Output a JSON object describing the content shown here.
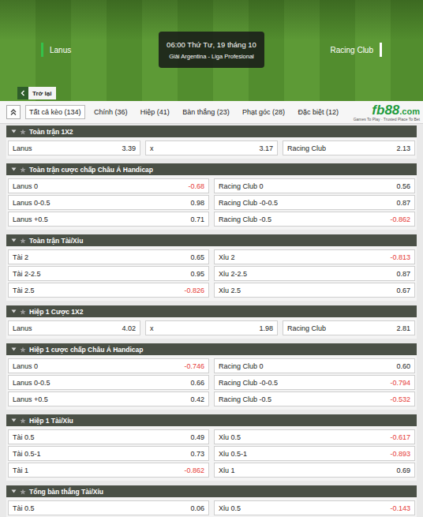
{
  "match": {
    "time": "06:00 Thứ Tư, 19 tháng 10",
    "league": "Giải Argentina - Liga Profesional",
    "home": "Lanus",
    "away": "Racing Club"
  },
  "back": {
    "label": "Trở lại"
  },
  "tabs": [
    {
      "label": "Tất cả kèo (134)",
      "selected": true
    },
    {
      "label": "Chính (36)",
      "selected": false
    },
    {
      "label": "Hiệp (41)",
      "selected": false
    },
    {
      "label": "Bàn thắng (23)",
      "selected": false
    },
    {
      "label": "Phạt góc (28)",
      "selected": false
    },
    {
      "label": "Đặc biệt (12)",
      "selected": false
    }
  ],
  "logo": {
    "brand": "fb88",
    "suffix": ".com",
    "tagline": "Games To Play · Trusted Place To Bet"
  },
  "sections": [
    {
      "title": "Toàn trận 1X2",
      "rows": [
        [
          {
            "label": "Lanus",
            "odds": "3.39",
            "negative": false
          },
          {
            "label": "x",
            "odds": "3.17",
            "negative": false
          },
          {
            "label": "Racing Club",
            "odds": "2.13",
            "negative": false
          }
        ]
      ]
    },
    {
      "title": "Toàn trận cược chấp Châu Á Handicap",
      "rows": [
        [
          {
            "label": "Lanus 0",
            "odds": "-0.68",
            "negative": true
          },
          {
            "label": "Racing Club 0",
            "odds": "0.56",
            "negative": false
          }
        ],
        [
          {
            "label": "Lanus 0-0.5",
            "odds": "0.98",
            "negative": false
          },
          {
            "label": "Racing Club -0-0.5",
            "odds": "0.87",
            "negative": false
          }
        ],
        [
          {
            "label": "Lanus +0.5",
            "odds": "0.71",
            "negative": false
          },
          {
            "label": "Racing Club -0.5",
            "odds": "-0.862",
            "negative": true
          }
        ]
      ]
    },
    {
      "title": "Toàn trận Tài/Xỉu",
      "rows": [
        [
          {
            "label": "Tài 2",
            "odds": "0.65",
            "negative": false
          },
          {
            "label": "Xỉu 2",
            "odds": "-0.813",
            "negative": true
          }
        ],
        [
          {
            "label": "Tài 2-2.5",
            "odds": "0.95",
            "negative": false
          },
          {
            "label": "Xỉu 2-2.5",
            "odds": "0.87",
            "negative": false
          }
        ],
        [
          {
            "label": "Tài 2.5",
            "odds": "-0.826",
            "negative": true
          },
          {
            "label": "Xỉu 2.5",
            "odds": "0.67",
            "negative": false
          }
        ]
      ]
    },
    {
      "title": "Hiệp 1 Cược 1X2",
      "rows": [
        [
          {
            "label": "Lanus",
            "odds": "4.02",
            "negative": false
          },
          {
            "label": "x",
            "odds": "1.98",
            "negative": false
          },
          {
            "label": "Racing Club",
            "odds": "2.81",
            "negative": false
          }
        ]
      ]
    },
    {
      "title": "Hiệp 1 cược chấp Châu Á Handicap",
      "rows": [
        [
          {
            "label": "Lanus 0",
            "odds": "-0.746",
            "negative": true
          },
          {
            "label": "Racing Club 0",
            "odds": "0.60",
            "negative": false
          }
        ],
        [
          {
            "label": "Lanus 0-0.5",
            "odds": "0.66",
            "negative": false
          },
          {
            "label": "Racing Club -0-0.5",
            "odds": "-0.794",
            "negative": true
          }
        ],
        [
          {
            "label": "Lanus +0.5",
            "odds": "0.42",
            "negative": false
          },
          {
            "label": "Racing Club -0.5",
            "odds": "-0.532",
            "negative": true
          }
        ]
      ]
    },
    {
      "title": "Hiệp 1 Tài/Xỉu",
      "rows": [
        [
          {
            "label": "Tài 0.5",
            "odds": "0.49",
            "negative": false
          },
          {
            "label": "Xỉu 0.5",
            "odds": "-0.617",
            "negative": true
          }
        ],
        [
          {
            "label": "Tài 0.5-1",
            "odds": "0.73",
            "negative": false
          },
          {
            "label": "Xỉu 0.5-1",
            "odds": "-0.893",
            "negative": true
          }
        ],
        [
          {
            "label": "Tài 1",
            "odds": "-0.862",
            "negative": true
          },
          {
            "label": "Xỉu 1",
            "odds": "0.69",
            "negative": false
          }
        ]
      ]
    },
    {
      "title": "Tổng bàn thắng Tài/Xỉu",
      "rows": [
        [
          {
            "label": "Tài 0.5",
            "odds": "0.06",
            "negative": false
          },
          {
            "label": "Xỉu 0.5",
            "odds": "-0.143",
            "negative": true
          }
        ]
      ]
    }
  ]
}
